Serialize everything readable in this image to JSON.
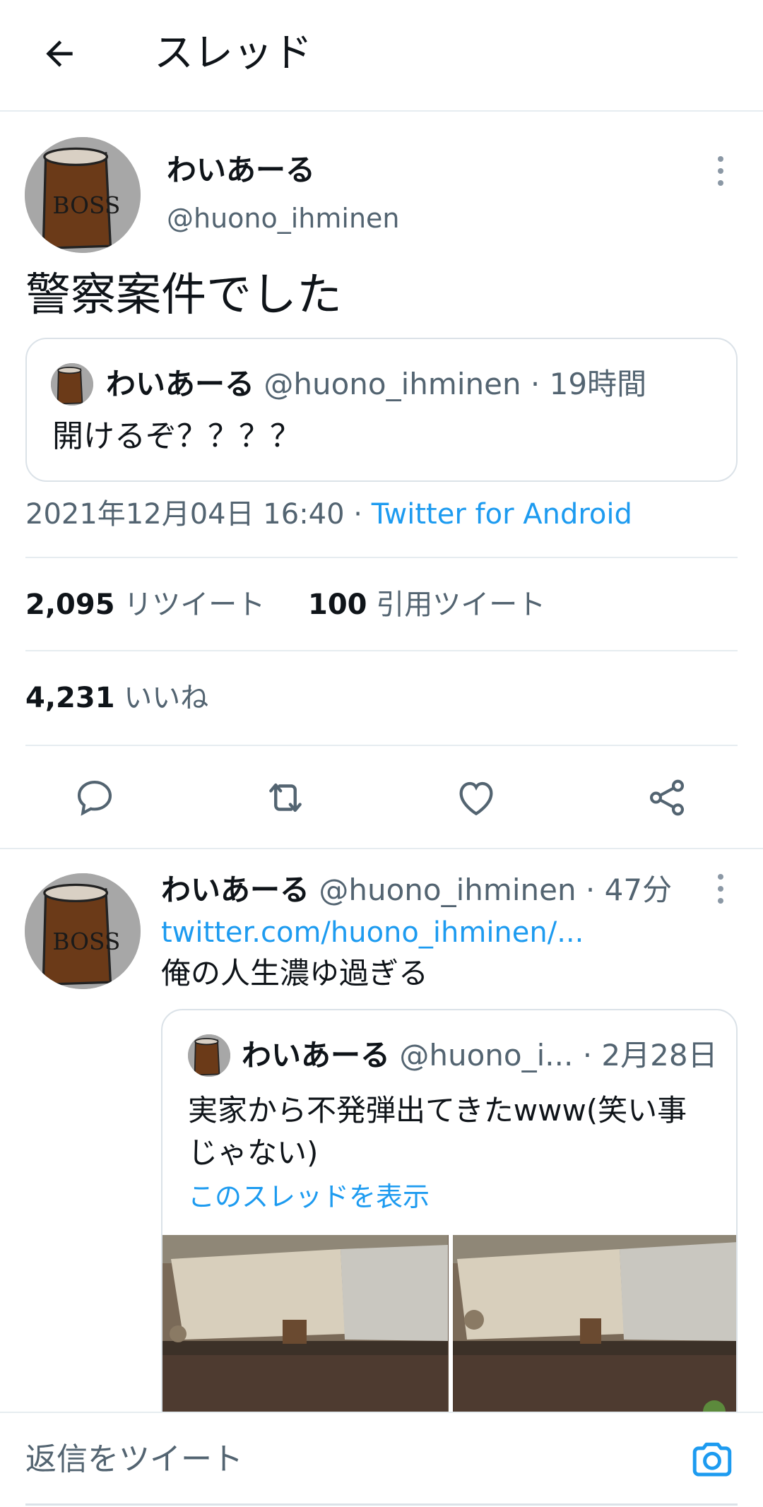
{
  "header": {
    "title": "スレッド",
    "back_icon": "arrow-left-icon"
  },
  "main_tweet": {
    "name": "わいあーる",
    "handle": "@huono_ihminen",
    "text": "警察案件でした",
    "quoted": {
      "name": "わいあーる",
      "meta": "@huono_ihminen · 19時間",
      "text": "開けるぞ？？？？"
    },
    "timestamp": "2021年12月04日 16:40 · ",
    "source": "Twitter for Android",
    "retweets": {
      "count": "2,095",
      "label": "リツイート"
    },
    "quotes": {
      "count": "100",
      "label": "引用ツイート"
    },
    "likes": {
      "count": "4,231",
      "label": "いいね"
    },
    "actions": [
      "reply-icon",
      "retweet-icon",
      "like-icon",
      "share-icon"
    ]
  },
  "reply_tweet": {
    "name": "わいあーる",
    "meta": "@huono_ihminen · 47分",
    "link": "twitter.com/huono_ihminen/...",
    "text": "俺の人生濃ゆ過ぎる",
    "quoted": {
      "name": "わいあーる",
      "meta": "@huono_i...  · 2月28日",
      "text": "実家から不発弾出てきたwww(笑い事じゃない)",
      "show_thread": "このスレッドを表示"
    }
  },
  "composer": {
    "placeholder": "返信をツイート",
    "camera_icon": "camera-icon"
  },
  "avatar_logo_text": "BOSS",
  "colors": {
    "accent": "#1d9bf0",
    "secondary_text": "#536471",
    "border": "#e6ecf0"
  }
}
